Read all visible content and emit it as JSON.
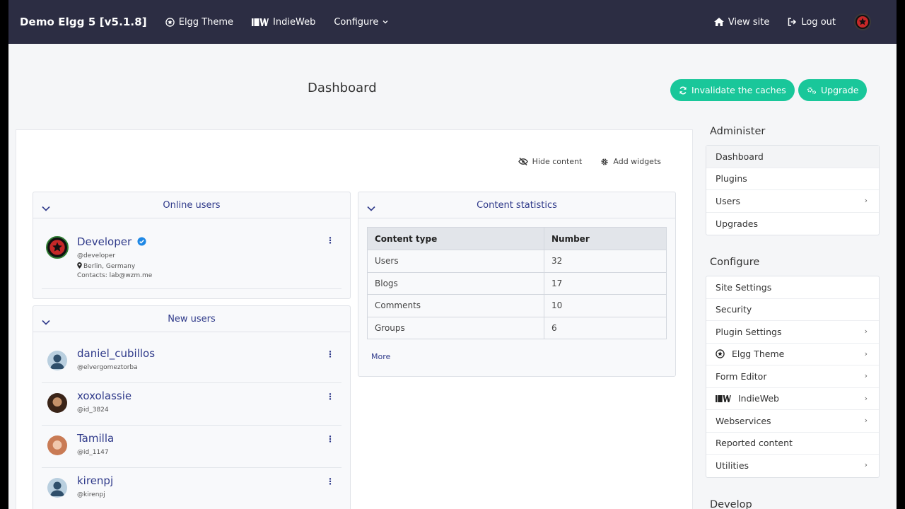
{
  "topbar": {
    "brand": "Demo Elgg 5 [v5.1.8]",
    "nav": [
      {
        "label": "Elgg Theme",
        "icon": "star-circle-icon"
      },
      {
        "label": "IndieWeb",
        "icon": "indieweb-icon"
      },
      {
        "label": "Configure",
        "icon": "chevron-down-icon"
      }
    ],
    "right": [
      {
        "label": "View site",
        "icon": "home-icon"
      },
      {
        "label": "Log out",
        "icon": "logout-icon"
      }
    ]
  },
  "page": {
    "title": "Dashboard",
    "buttons": [
      {
        "label": "Invalidate the caches",
        "icon": "refresh-icon"
      },
      {
        "label": "Upgrade",
        "icon": "gears-icon"
      }
    ],
    "toolbar": {
      "hide_content": "Hide content",
      "add_widgets": "Add widgets"
    }
  },
  "online_users": {
    "title": "Online users",
    "user": {
      "name": "Developer",
      "handle": "@developer",
      "location": "Berlin, Germany",
      "contacts": "Contacts: lab@wzm.me"
    }
  },
  "new_users": {
    "title": "New users",
    "users": [
      {
        "name": "daniel_cubillos",
        "handle": "@elvergomeztorba"
      },
      {
        "name": "xoxolassie",
        "handle": "@id_3824"
      },
      {
        "name": "Tamilla",
        "handle": "@id_1147"
      },
      {
        "name": "kirenpj",
        "handle": "@kirenpj"
      }
    ]
  },
  "content_stats": {
    "title": "Content statistics",
    "headers": [
      "Content type",
      "Number"
    ],
    "rows": [
      [
        "Users",
        "32"
      ],
      [
        "Blogs",
        "17"
      ],
      [
        "Comments",
        "10"
      ],
      [
        "Groups",
        "6"
      ]
    ],
    "more": "More"
  },
  "sidebar": {
    "administer_title": "Administer",
    "administer": [
      {
        "label": "Dashboard"
      },
      {
        "label": "Plugins"
      },
      {
        "label": "Users",
        "chevron": "›"
      },
      {
        "label": "Upgrades"
      }
    ],
    "configure_title": "Configure",
    "configure": [
      {
        "label": "Site Settings"
      },
      {
        "label": "Security"
      },
      {
        "label": "Plugin Settings",
        "chevron": "›"
      },
      {
        "label": "Elgg Theme",
        "chevron": "›",
        "icon": "star-circle-icon"
      },
      {
        "label": "Form Editor",
        "chevron": "›"
      },
      {
        "label": "IndieWeb",
        "chevron": "›",
        "icon": "indieweb-icon"
      },
      {
        "label": "Webservices",
        "chevron": "›"
      },
      {
        "label": "Reported content"
      },
      {
        "label": "Utilities",
        "chevron": "›"
      }
    ],
    "develop_title": "Develop"
  },
  "colors": {
    "topbar": "#2c2d43",
    "accent": "#19c79a",
    "link": "#2f3a8a",
    "arrow": "#e91ed6"
  }
}
